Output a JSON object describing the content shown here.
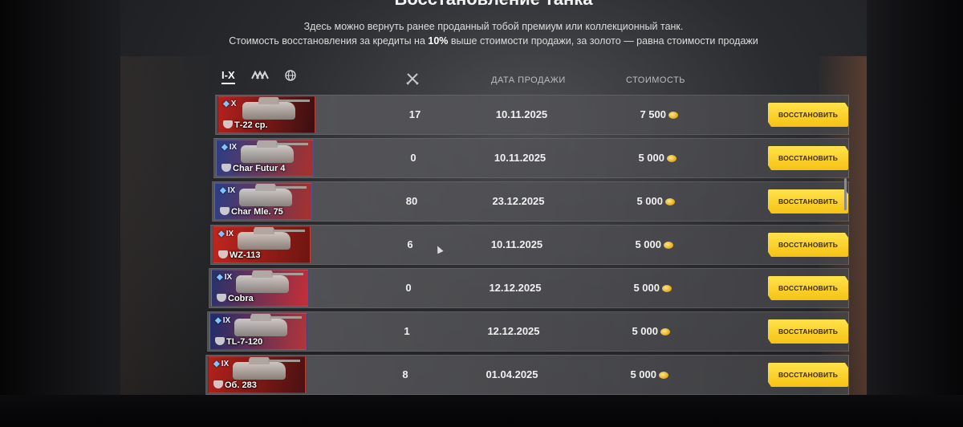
{
  "header": {
    "title": "Восстановление танка",
    "subtitle_line1": "Здесь можно вернуть ранее проданный тобой премиум или коллекционный танк.",
    "subtitle_line2_pre": "Стоимость восстановления за кредиты на ",
    "subtitle_line2_bold": "10%",
    "subtitle_line2_post": " выше стоимости продажи, за золото — равна стоимости продажи"
  },
  "filters": {
    "tier": "I-X",
    "class_icon": "vehicle-class-icon",
    "nation_icon": "globe-icon"
  },
  "columns": {
    "battles_icon": "crossed-swords-icon",
    "date": "ДАТА ПРОДАЖИ",
    "cost": "СТОИМОСТЬ"
  },
  "restore_label": "ВОССТАНОВИТЬ",
  "rows": [
    {
      "tier": "X",
      "name": "Т-22 ср.",
      "battles": "17",
      "date": "10.11.2025",
      "cost": "7 500",
      "flag_colors": [
        "#b6211d",
        "#3a0f10"
      ]
    },
    {
      "tier": "IX",
      "name": "Char Futur 4",
      "battles": "0",
      "date": "10.11.2025",
      "cost": "5 000",
      "flag_colors": [
        "#2b3e86",
        "#a9312c"
      ]
    },
    {
      "tier": "IX",
      "name": "Char Mle. 75",
      "battles": "80",
      "date": "23.12.2025",
      "cost": "5 000",
      "flag_colors": [
        "#2b3e86",
        "#a9312c"
      ]
    },
    {
      "tier": "IX",
      "name": "WZ-113",
      "battles": "6",
      "date": "10.11.2025",
      "cost": "5 000",
      "flag_colors": [
        "#c0261d",
        "#6e1512"
      ]
    },
    {
      "tier": "IX",
      "name": "Cobra",
      "battles": "0",
      "date": "12.12.2025",
      "cost": "5 000",
      "flag_colors": [
        "#24326e",
        "#c62f36"
      ]
    },
    {
      "tier": "IX",
      "name": "TL-7-120",
      "battles": "1",
      "date": "12.12.2025",
      "cost": "5 000",
      "flag_colors": [
        "#1f2d6b",
        "#b4353a"
      ]
    },
    {
      "tier": "IX",
      "name": "Об. 283",
      "battles": "8",
      "date": "01.04.2025",
      "cost": "5 000",
      "flag_colors": [
        "#b2211c",
        "#4a1111"
      ]
    }
  ],
  "colors": {
    "button": "#f6c214",
    "gold": "#e2a517"
  }
}
